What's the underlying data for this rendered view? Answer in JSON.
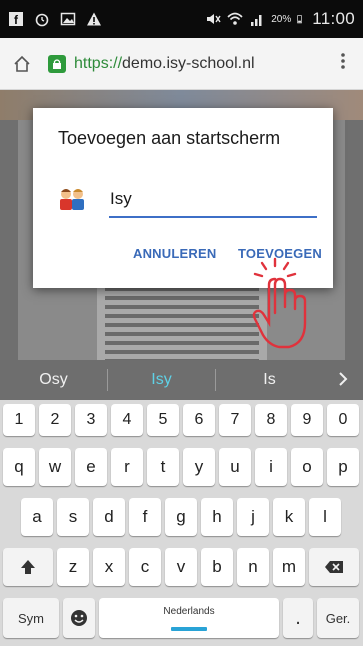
{
  "status_bar": {
    "battery_percent": "20%",
    "time": "11:00"
  },
  "browser": {
    "url_scheme": "https://",
    "url_host": "demo.isy-school.nl"
  },
  "dialog": {
    "title": "Toevoegen aan startscherm",
    "input_value": "Isy",
    "cancel_label": "ANNULEREN",
    "add_label": "TOEVOEGEN"
  },
  "suggestions": [
    "Osy",
    "Isy",
    "Is"
  ],
  "keyboard": {
    "row_numbers": [
      "1",
      "2",
      "3",
      "4",
      "5",
      "6",
      "7",
      "8",
      "9",
      "0"
    ],
    "row1": [
      "q",
      "w",
      "e",
      "r",
      "t",
      "y",
      "u",
      "i",
      "o",
      "p"
    ],
    "row2": [
      "a",
      "s",
      "d",
      "f",
      "g",
      "h",
      "j",
      "k",
      "l"
    ],
    "row3": [
      "z",
      "x",
      "c",
      "v",
      "b",
      "n",
      "m"
    ],
    "sym_label": "Sym",
    "space_label": "Nederlands",
    "go_label": "Ger."
  },
  "colors": {
    "accent": "#3a6ab8",
    "suggestion_active": "#5fd1e6",
    "hand": "#e0323c"
  }
}
